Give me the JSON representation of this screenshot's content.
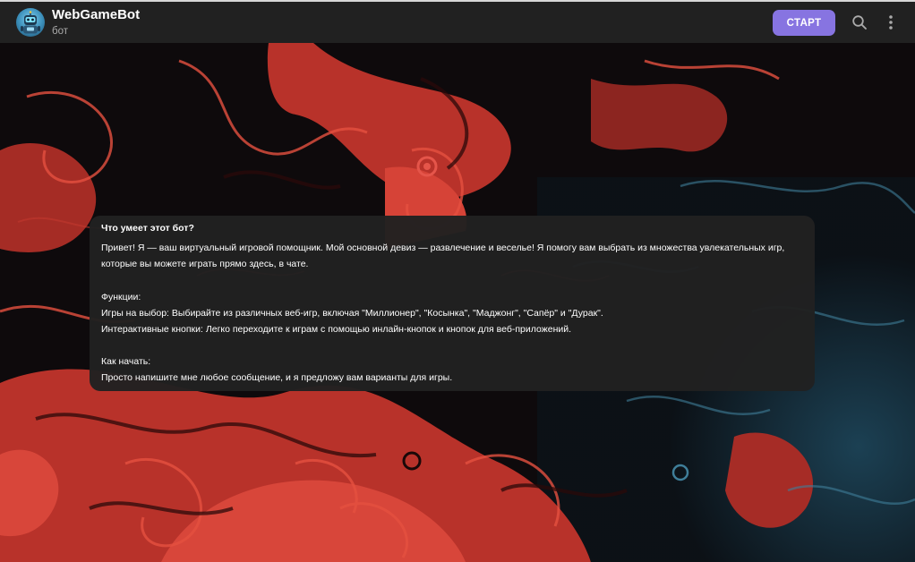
{
  "header": {
    "bot_name": "WebGameBot",
    "status": "бот",
    "start_button": "СТАРТ",
    "icons": [
      "bot-avatar",
      "search-icon",
      "more-vertical-icon"
    ],
    "accent_color": "#8774e1",
    "background_color": "#212121"
  },
  "card": {
    "title": "Что умеет этот бот?",
    "intro": [
      "Привет! Я — ваш виртуальный игровой помощник. Мой основной девиз — развлечение и веселье! Я помогу вам выбрать из множества увлекательных игр,",
      "которые вы можете играть прямо здесь, в чате."
    ],
    "features_heading": "Функции:",
    "features": [
      "Игры на выбор: Выбирайте из различных веб-игр, включая \"Миллионер\", \"Косынка\", \"Маджонг\", \"Сапёр\" и \"Дурак\".",
      "Интерактивные кнопки: Легко переходите к играм с помощью инлайн-кнопок и кнопок для веб-приложений."
    ],
    "howto_heading": "Как начать:",
    "howto": "Просто напишите мне любое сообщение, и я предложу вам варианты для игры.",
    "background_color": "#212121"
  },
  "wallpaper": {
    "colors": [
      "#0d0a0c",
      "#c0392b",
      "#e24b3c",
      "#2a5a70"
    ]
  }
}
